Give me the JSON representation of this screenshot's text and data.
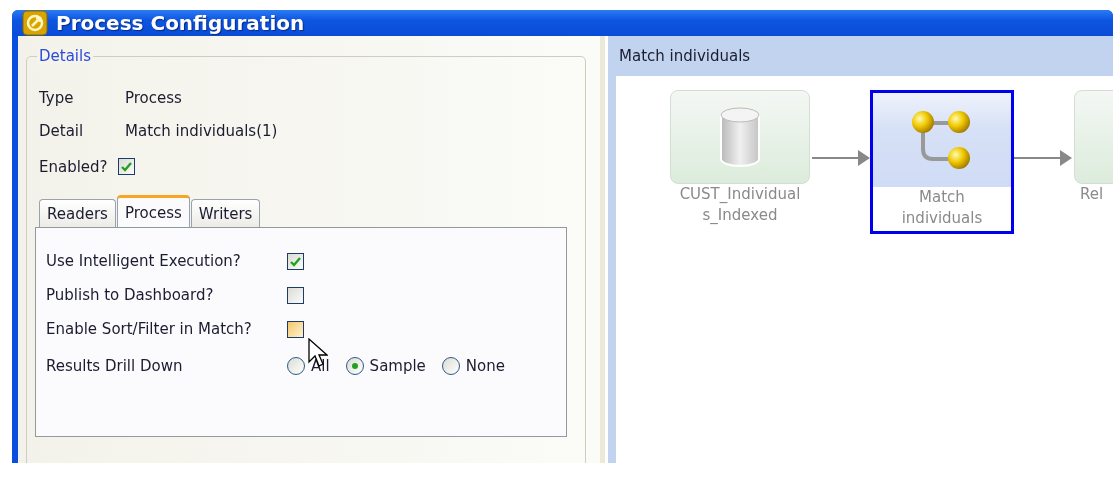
{
  "window": {
    "title": "Process Configuration"
  },
  "details": {
    "legend": "Details",
    "fields": [
      {
        "label": "Type",
        "value": "Process"
      },
      {
        "label": "Detail",
        "value": "Match individuals(1)"
      }
    ],
    "enabled": {
      "label": "Enabled?",
      "checked": true
    }
  },
  "tabs": [
    {
      "label": "Readers",
      "selected": false
    },
    {
      "label": "Process",
      "selected": true
    },
    {
      "label": "Writers",
      "selected": false
    }
  ],
  "options": [
    {
      "label": "Use Intelligent Execution?",
      "checked": true,
      "hovered": false
    },
    {
      "label": "Publish to Dashboard?",
      "checked": false,
      "hovered": false
    },
    {
      "label": "Enable Sort/Filter in Match?",
      "checked": false,
      "hovered": true
    }
  ],
  "drill_down": {
    "label": "Results Drill Down",
    "choices": [
      {
        "label": "All",
        "selected": false
      },
      {
        "label": "Sample",
        "selected": true
      },
      {
        "label": "None",
        "selected": false
      }
    ]
  },
  "diagram": {
    "title": "Match individuals",
    "nodes": [
      {
        "kind": "reader",
        "label": "CUST_Individual s_Indexed",
        "selected": false
      },
      {
        "kind": "process",
        "label": "Match individuals",
        "selected": true
      },
      {
        "kind": "reader",
        "label": "Rel",
        "selected": false
      }
    ]
  }
}
